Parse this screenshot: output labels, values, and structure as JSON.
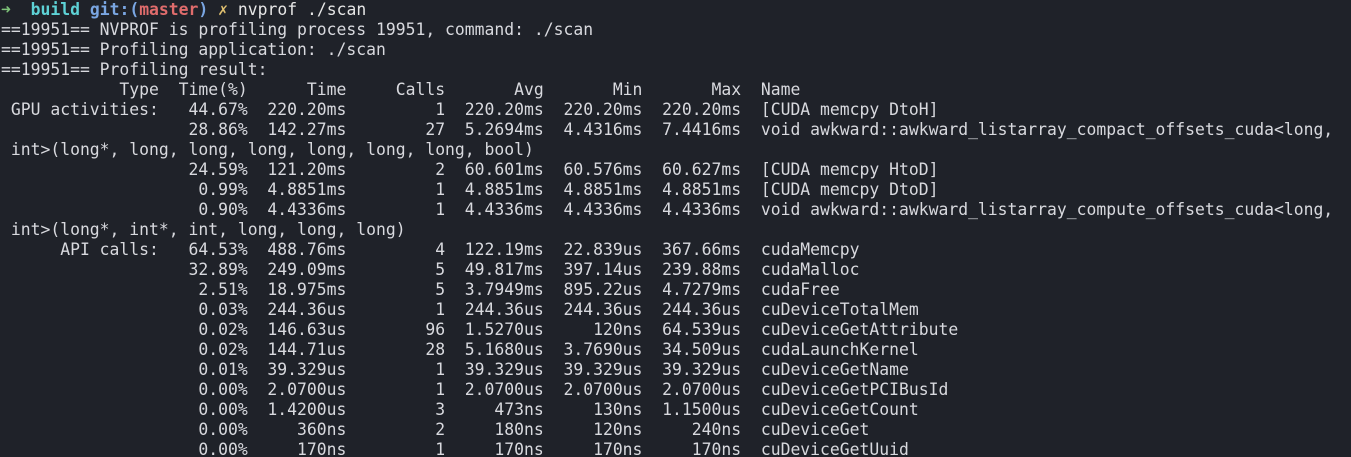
{
  "terminal": {
    "prompt": {
      "arrow": "➜",
      "dir": "build",
      "git_label": "git:(",
      "branch": "master",
      "git_close": ")",
      "dirty": "✗",
      "command": "nvprof ./scan"
    },
    "output_lines": [
      "==19951== NVPROF is profiling process 19951, command: ./scan",
      "==19951== Profiling application: ./scan",
      "==19951== Profiling result:",
      "            Type  Time(%)      Time     Calls       Avg       Min       Max  Name",
      " GPU activities:   44.67%  220.20ms         1  220.20ms  220.20ms  220.20ms  [CUDA memcpy DtoH]",
      "                   28.86%  142.27ms        27  5.2694ms  4.4316ms  7.4416ms  void awkward::awkward_listarray_compact_offsets_cuda<long,",
      " int>(long*, long, long, long, long, long, long, bool)",
      "                   24.59%  121.20ms         2  60.601ms  60.576ms  60.627ms  [CUDA memcpy HtoD]",
      "                    0.99%  4.8851ms         1  4.8851ms  4.8851ms  4.8851ms  [CUDA memcpy DtoD]",
      "                    0.90%  4.4336ms         1  4.4336ms  4.4336ms  4.4336ms  void awkward::awkward_listarray_compute_offsets_cuda<long,",
      " int>(long*, int*, int, long, long, long)",
      "      API calls:   64.53%  488.76ms         4  122.19ms  22.839us  367.66ms  cudaMemcpy",
      "                   32.89%  249.09ms         5  49.817ms  397.14us  239.88ms  cudaMalloc",
      "                    2.51%  18.975ms         5  3.7949ms  895.22us  4.7279ms  cudaFree",
      "                    0.03%  244.36us         1  244.36us  244.36us  244.36us  cuDeviceTotalMem",
      "                    0.02%  146.63us        96  1.5270us     120ns  64.539us  cuDeviceGetAttribute",
      "                    0.02%  144.71us        28  5.1680us  3.7690us  34.509us  cudaLaunchKernel",
      "                    0.01%  39.329us         1  39.329us  39.329us  39.329us  cuDeviceGetName",
      "                    0.00%  2.0700us         1  2.0700us  2.0700us  2.0700us  cuDeviceGetPCIBusId",
      "                    0.00%  1.4200us         3     473ns     130ns  1.1500us  cuDeviceGetCount",
      "                    0.00%     360ns         2     180ns     120ns     240ns  cuDeviceGet",
      "                    0.00%     170ns         1     170ns     170ns     170ns  cuDeviceGetUuid"
    ]
  }
}
